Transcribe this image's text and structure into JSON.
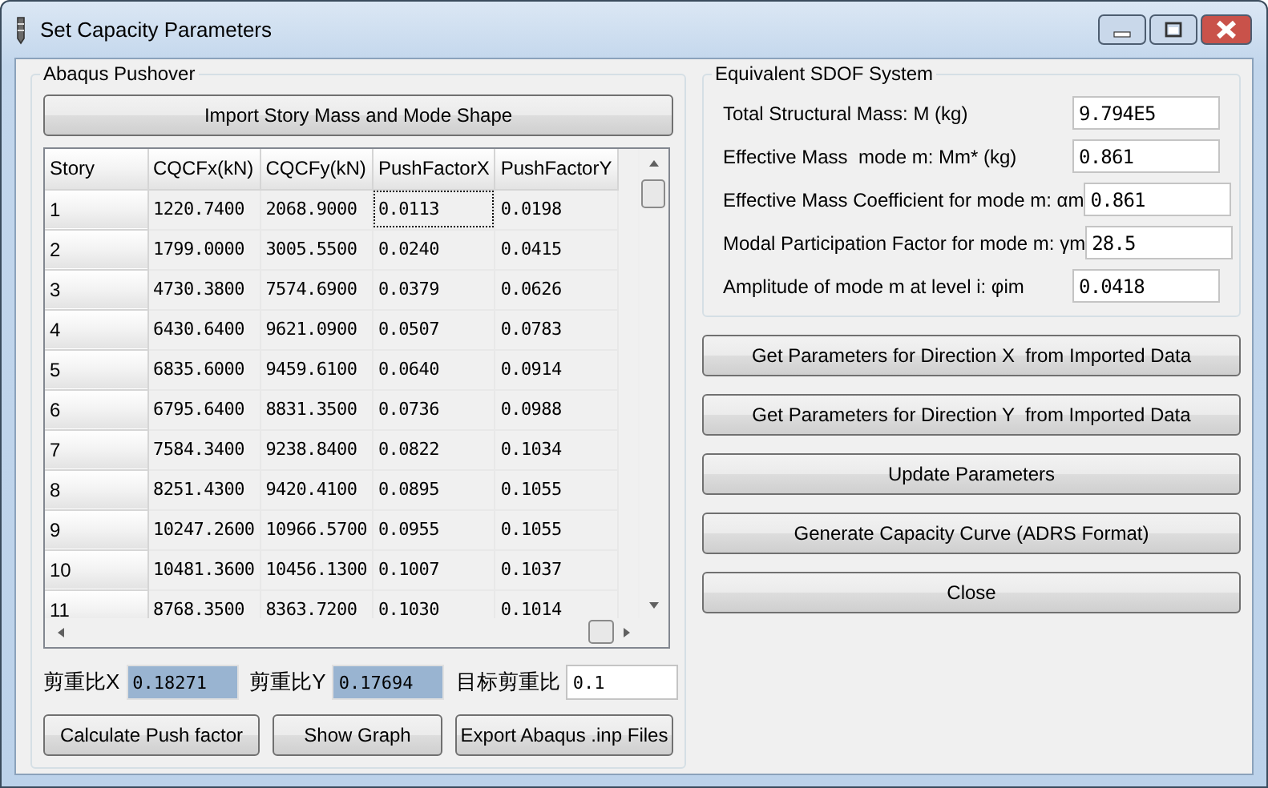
{
  "window": {
    "title": "Set Capacity Parameters"
  },
  "pushover": {
    "title": "Abaqus Pushover",
    "import_button": "Import Story Mass and Mode Shape",
    "table": {
      "columns": [
        "Story",
        "CQCFx(kN)",
        "CQCFy(kN)",
        "PushFactorX",
        "PushFactorY"
      ],
      "rows": [
        {
          "cells": [
            "1",
            "1220.7400",
            "2068.9000",
            "0.0113",
            "0.0198"
          ],
          "focused": [
            false,
            false,
            false,
            true,
            false
          ]
        },
        {
          "cells": [
            "2",
            "1799.0000",
            "3005.5500",
            "0.0240",
            "0.0415"
          ],
          "focused": [
            false,
            false,
            false,
            false,
            false
          ]
        },
        {
          "cells": [
            "3",
            "4730.3800",
            "7574.6900",
            "0.0379",
            "0.0626"
          ],
          "focused": [
            false,
            false,
            false,
            false,
            false
          ]
        },
        {
          "cells": [
            "4",
            "6430.6400",
            "9621.0900",
            "0.0507",
            "0.0783"
          ],
          "focused": [
            false,
            false,
            false,
            false,
            false
          ]
        },
        {
          "cells": [
            "5",
            "6835.6000",
            "9459.6100",
            "0.0640",
            "0.0914"
          ],
          "focused": [
            false,
            false,
            false,
            false,
            false
          ]
        },
        {
          "cells": [
            "6",
            "6795.6400",
            "8831.3500",
            "0.0736",
            "0.0988"
          ],
          "focused": [
            false,
            false,
            false,
            false,
            false
          ]
        },
        {
          "cells": [
            "7",
            "7584.3400",
            "9238.8400",
            "0.0822",
            "0.1034"
          ],
          "focused": [
            false,
            false,
            false,
            false,
            false
          ]
        },
        {
          "cells": [
            "8",
            "8251.4300",
            "9420.4100",
            "0.0895",
            "0.1055"
          ],
          "focused": [
            false,
            false,
            false,
            false,
            false
          ]
        },
        {
          "cells": [
            "9",
            "10247.2600",
            "10966.5700",
            "0.0955",
            "0.1055"
          ],
          "focused": [
            false,
            false,
            false,
            false,
            false
          ]
        },
        {
          "cells": [
            "10",
            "10481.3600",
            "10456.1300",
            "0.1007",
            "0.1037"
          ],
          "focused": [
            false,
            false,
            false,
            false,
            false
          ]
        },
        {
          "cells": [
            "11",
            "8768.3500",
            "8363.7200",
            "0.1030",
            "0.1014"
          ],
          "focused": [
            false,
            false,
            false,
            false,
            false
          ]
        }
      ]
    },
    "ratios": [
      {
        "label": "剪重比X",
        "value": "0.18271",
        "highlighted": true
      },
      {
        "label": "剪重比Y",
        "value": "0.17694",
        "highlighted": true
      },
      {
        "label": "目标剪重比",
        "value": "0.1",
        "highlighted": false
      }
    ],
    "buttons": [
      "Calculate Push factor",
      "Show Graph",
      "Export Abaqus .inp Files"
    ]
  },
  "sdof": {
    "title": "Equivalent SDOF System",
    "fields": [
      {
        "label": "Total Structural Mass: M (kg)",
        "value": "9.794E5"
      },
      {
        "label": "Effective Mass  mode m: Mm* (kg)",
        "value": "0.861"
      },
      {
        "label": "Effective Mass Coefficient for mode m: αm",
        "value": "0.861"
      },
      {
        "label": "Modal Participation Factor for mode m: γm",
        "value": "28.5"
      },
      {
        "label": "Amplitude of mode m at level i: φim",
        "value": "0.0418"
      }
    ]
  },
  "actions": [
    "Get Parameters for Direction X  from Imported Data",
    "Get Parameters for Direction Y  from Imported Data",
    "Update Parameters",
    "Generate Capacity Curve (ADRS Format)",
    "Close"
  ]
}
